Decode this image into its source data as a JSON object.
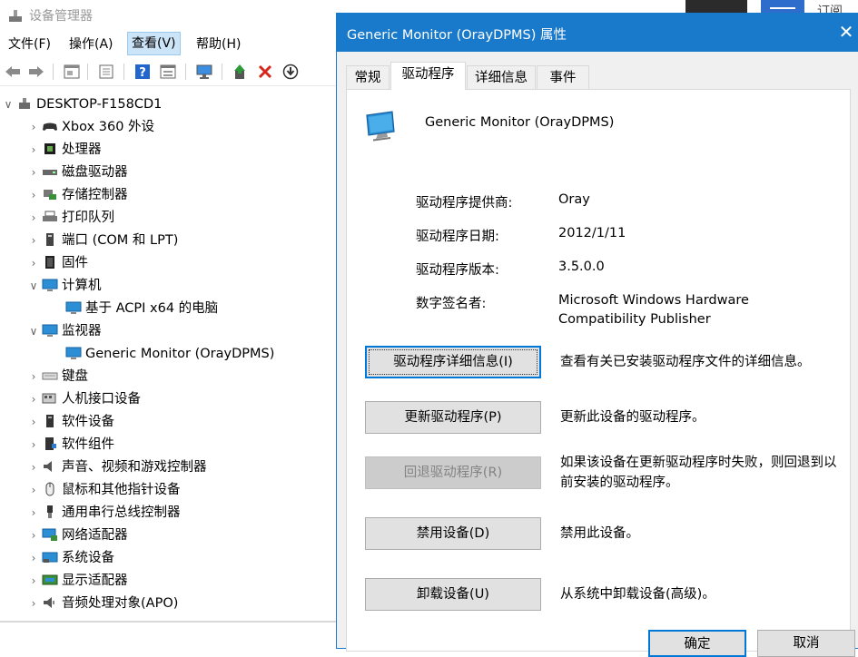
{
  "device_manager": {
    "title": "设备管理器",
    "taskbar_partial_text": "订阅",
    "menu": [
      "文件(F)",
      "操作(A)",
      "查看(V)",
      "帮助(H)"
    ],
    "active_menu_index": 2,
    "toolbar_icons": [
      "back-arrow-icon",
      "forward-arrow-icon",
      "properties-icon",
      "help-page-icon",
      "help-icon",
      "show-hide-icon",
      "scan-hardware-icon",
      "update-driver-icon",
      "uninstall-x-icon",
      "download-icon"
    ],
    "tree": {
      "root": "DESKTOP-F158CD1",
      "items": [
        {
          "label": "Xbox 360 外设",
          "expanded": false,
          "icon": "gamepad-icon"
        },
        {
          "label": "处理器",
          "expanded": false,
          "icon": "cpu-icon"
        },
        {
          "label": "磁盘驱动器",
          "expanded": false,
          "icon": "disk-drive-icon"
        },
        {
          "label": "存储控制器",
          "expanded": false,
          "icon": "storage-controller-icon"
        },
        {
          "label": "打印队列",
          "expanded": false,
          "icon": "printer-icon"
        },
        {
          "label": "端口 (COM 和 LPT)",
          "expanded": false,
          "icon": "port-icon"
        },
        {
          "label": "固件",
          "expanded": false,
          "icon": "firmware-icon"
        },
        {
          "label": "计算机",
          "expanded": true,
          "icon": "computer-icon"
        },
        {
          "label": "基于 ACPI x64 的电脑",
          "child": true,
          "icon": "monitor-icon"
        },
        {
          "label": "监视器",
          "expanded": true,
          "icon": "monitor-icon"
        },
        {
          "label": "Generic Monitor (OrayDPMS)",
          "child": true,
          "icon": "monitor-icon"
        },
        {
          "label": "键盘",
          "expanded": false,
          "icon": "keyboard-icon"
        },
        {
          "label": "人机接口设备",
          "expanded": false,
          "icon": "hid-icon"
        },
        {
          "label": "软件设备",
          "expanded": false,
          "icon": "software-device-icon"
        },
        {
          "label": "软件组件",
          "expanded": false,
          "icon": "software-component-icon"
        },
        {
          "label": "声音、视频和游戏控制器",
          "expanded": false,
          "icon": "speaker-icon"
        },
        {
          "label": "鼠标和其他指针设备",
          "expanded": false,
          "icon": "mouse-icon"
        },
        {
          "label": "通用串行总线控制器",
          "expanded": false,
          "icon": "usb-icon"
        },
        {
          "label": "网络适配器",
          "expanded": false,
          "icon": "network-adapter-icon"
        },
        {
          "label": "系统设备",
          "expanded": false,
          "icon": "system-device-icon"
        },
        {
          "label": "显示适配器",
          "expanded": false,
          "icon": "display-adapter-icon"
        },
        {
          "label": "音频处理对象(APO)",
          "expanded": false,
          "icon": "audio-processing-icon"
        }
      ]
    }
  },
  "dialog": {
    "title": "Generic Monitor (OrayDPMS) 属性",
    "tabs": [
      "常规",
      "驱动程序",
      "详细信息",
      "事件"
    ],
    "active_tab_index": 1,
    "device_name": "Generic Monitor (OrayDPMS)",
    "properties": {
      "provider_label": "驱动程序提供商:",
      "provider": "Oray",
      "date_label": "驱动程序日期:",
      "date": "2012/1/11",
      "version_label": "驱动程序版本:",
      "version": "3.5.0.0",
      "signer_label": "数字签名者:",
      "signer_line1": "Microsoft Windows Hardware",
      "signer_line2": "Compatibility Publisher"
    },
    "buttons": {
      "details": "驱动程序详细信息(I)",
      "details_desc": "查看有关已安装驱动程序文件的详细信息。",
      "update": "更新驱动程序(P)",
      "update_desc": "更新此设备的驱动程序。",
      "rollback": "回退驱动程序(R)",
      "rollback_desc": "如果该设备在更新驱动程序时失败，则回退到以前安装的驱动程序。",
      "disable": "禁用设备(D)",
      "disable_desc": "禁用此设备。",
      "uninstall": "卸载设备(U)",
      "uninstall_desc": "从系统中卸载设备(高级)。"
    },
    "footer": {
      "ok": "确定",
      "cancel": "取消"
    }
  },
  "colors": {
    "accent": "#1979ca",
    "dialog_bg": "#f0f0f0",
    "button_bg": "#e1e1e1",
    "focus_border": "#0078d7"
  }
}
